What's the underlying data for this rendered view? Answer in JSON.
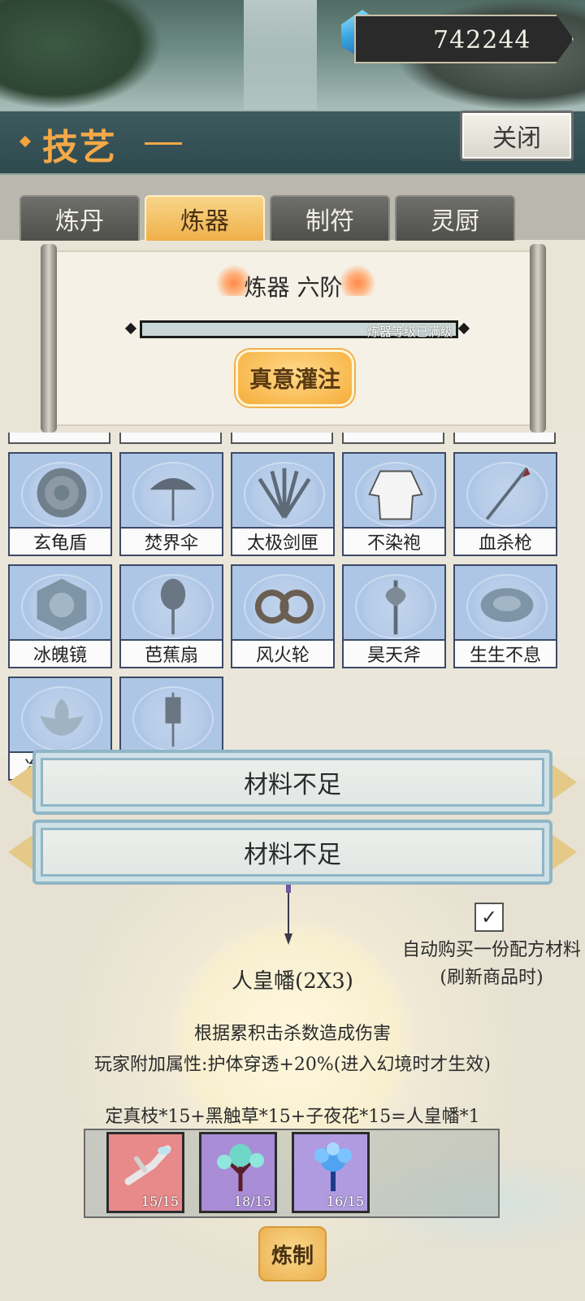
{
  "currency": {
    "amount": "742244",
    "icon": "blue-gem-plus-icon"
  },
  "header": {
    "title": "技艺",
    "close_label": "关闭"
  },
  "tabs": [
    {
      "label": "炼丹",
      "active": false
    },
    {
      "label": "炼器",
      "active": true
    },
    {
      "label": "制符",
      "active": false
    },
    {
      "label": "灵厨",
      "active": false
    }
  ],
  "panel": {
    "rank": "炼器 六阶",
    "progress_text": "炼器等级已满级",
    "progress": 1.0,
    "infuse_label": "真意灌注"
  },
  "items": [
    {
      "label": "玄龟盾"
    },
    {
      "label": "焚界伞"
    },
    {
      "label": "太极剑匣"
    },
    {
      "label": "不染袍"
    },
    {
      "label": "血杀枪"
    },
    {
      "label": "冰魄镜"
    },
    {
      "label": "芭蕉扇"
    },
    {
      "label": "风火轮"
    },
    {
      "label": "昊天斧"
    },
    {
      "label": "生生不息"
    },
    {
      "label": "净世莲台"
    },
    {
      "label": "人皇幡"
    }
  ],
  "toasts": [
    "材料不足",
    "材料不足"
  ],
  "detail": {
    "auto_buy_line1": "自动购买一份配方材料",
    "auto_buy_line2": "(刷新商品时)",
    "auto_buy_checked": true,
    "item_name": "人皇幡(2X3)",
    "desc1": "根据累积击杀数造成伤害",
    "desc2": "玩家附加属性:护体穿透+20%(进入幻境时才生效)",
    "formula": "定真枝*15+黑触草*15+子夜花*15=人皇幡*1",
    "materials": [
      {
        "count": "15/15",
        "bg": "#e8898a",
        "icon": "branch-icon"
      },
      {
        "count": "18/15",
        "bg": "#a98dd6",
        "icon": "black-grass-icon"
      },
      {
        "count": "16/15",
        "bg": "#b09be0",
        "icon": "midnight-flower-icon"
      }
    ],
    "craft_label": "炼制"
  }
}
